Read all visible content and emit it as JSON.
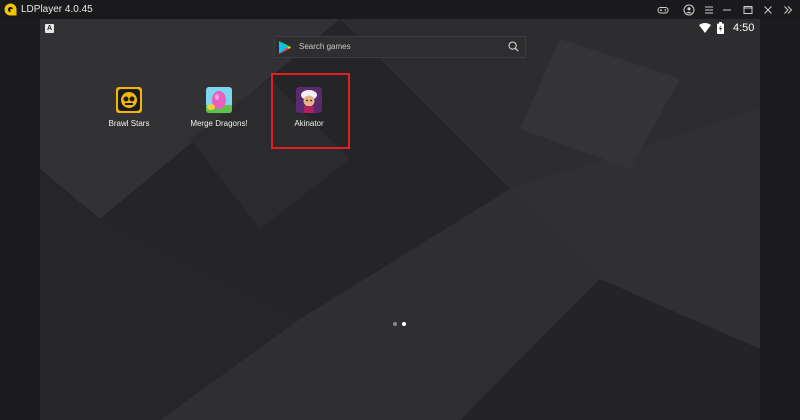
{
  "window": {
    "title": "LDPlayer 4.0.45",
    "logo_icon": "ldplayer-logo-icon",
    "controls": [
      "gamepad-icon",
      "account-icon",
      "menu-icon",
      "minimize-icon",
      "maximize-icon",
      "close-icon",
      "expand-sidebar-icon"
    ]
  },
  "statusbar": {
    "badge": "A",
    "time": "4:50"
  },
  "search": {
    "placeholder": "Search games"
  },
  "apps": [
    {
      "label": "Brawl Stars",
      "icon": "brawl-stars-icon"
    },
    {
      "label": "Merge Dragons!",
      "icon": "merge-dragons-icon"
    },
    {
      "label": "Akinator",
      "icon": "akinator-icon"
    }
  ],
  "colors": {
    "accent_logo": "#f5c400",
    "highlight": "#e02020",
    "background": "#2a2a2c"
  },
  "pager": {
    "page_count": 2,
    "active_page": 2
  }
}
